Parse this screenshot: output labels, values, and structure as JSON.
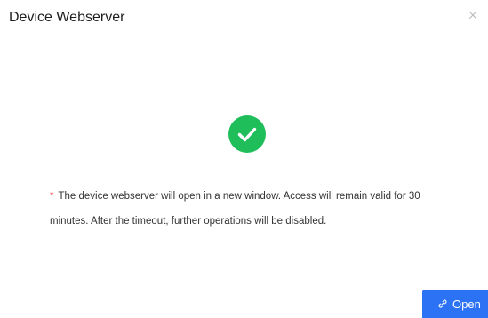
{
  "dialog": {
    "title": "Device Webserver",
    "close_icon": "close-icon",
    "status_icon": "success-check-icon",
    "message": {
      "required_marker": "*",
      "text": "The device webserver will open in a new window. Access will remain valid for 30 minutes. After the timeout, further operations will be disabled."
    },
    "open_button": {
      "icon": "link-icon",
      "label": "Open"
    }
  },
  "colors": {
    "success": "#1fbe5a",
    "primary": "#2b72f5",
    "required": "#ff4d4f"
  }
}
